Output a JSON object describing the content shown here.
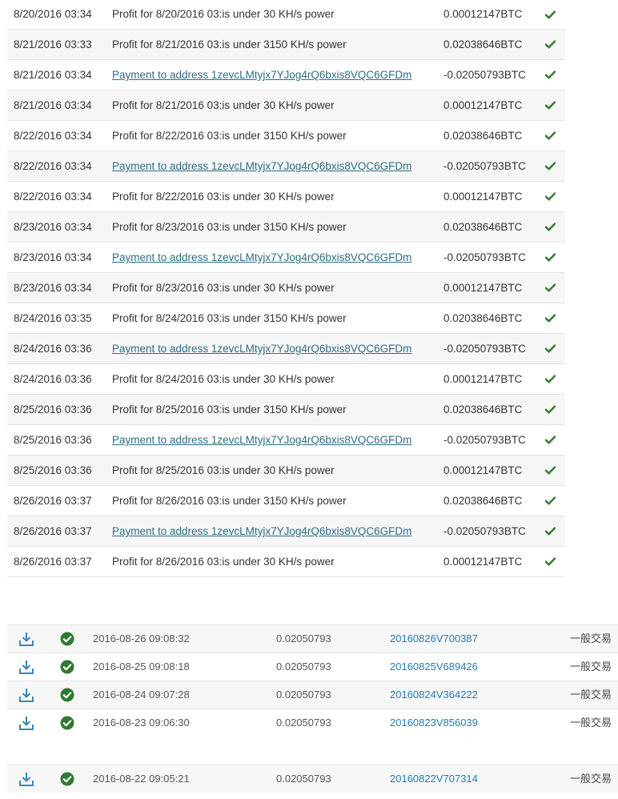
{
  "ledger": {
    "rows": [
      {
        "date": "8/20/2016 03:34",
        "desc": "Profit for 8/20/2016 03:is under 30 KH/s power",
        "amount": "0.00012147BTC",
        "link": false
      },
      {
        "date": "8/21/2016 03:33",
        "desc": "Profit for 8/21/2016 03:is under 3150 KH/s power",
        "amount": "0.02038646BTC",
        "link": false
      },
      {
        "date": "8/21/2016 03:34",
        "desc": "Payment to address 1zevcLMtyjx7YJog4rQ6bxis8VQC6GFDm",
        "amount": "-0.02050793BTC",
        "link": true
      },
      {
        "date": "8/21/2016 03:34",
        "desc": "Profit for 8/21/2016 03:is under 30 KH/s power",
        "amount": "0.00012147BTC",
        "link": false
      },
      {
        "date": "8/22/2016 03:34",
        "desc": "Profit for 8/22/2016 03:is under 3150 KH/s power",
        "amount": "0.02038646BTC",
        "link": false
      },
      {
        "date": "8/22/2016 03:34",
        "desc": "Payment to address 1zevcLMtyjx7YJog4rQ6bxis8VQC6GFDm",
        "amount": "-0.02050793BTC",
        "link": true
      },
      {
        "date": "8/22/2016 03:34",
        "desc": "Profit for 8/22/2016 03:is under 30 KH/s power",
        "amount": "0.00012147BTC",
        "link": false
      },
      {
        "date": "8/23/2016 03:34",
        "desc": "Profit for 8/23/2016 03:is under 3150 KH/s power",
        "amount": "0.02038646BTC",
        "link": false
      },
      {
        "date": "8/23/2016 03:34",
        "desc": "Payment to address 1zevcLMtyjx7YJog4rQ6bxis8VQC6GFDm",
        "amount": "-0.02050793BTC",
        "link": true
      },
      {
        "date": "8/23/2016 03:34",
        "desc": "Profit for 8/23/2016 03:is under 30 KH/s power",
        "amount": "0.00012147BTC",
        "link": false
      },
      {
        "date": "8/24/2016 03:35",
        "desc": "Profit for 8/24/2016 03:is under 3150 KH/s power",
        "amount": "0.02038646BTC",
        "link": false
      },
      {
        "date": "8/24/2016 03:36",
        "desc": "Payment to address 1zevcLMtyjx7YJog4rQ6bxis8VQC6GFDm",
        "amount": "-0.02050793BTC",
        "link": true
      },
      {
        "date": "8/24/2016 03:36",
        "desc": "Profit for 8/24/2016 03:is under 30 KH/s power",
        "amount": "0.00012147BTC",
        "link": false
      },
      {
        "date": "8/25/2016 03:36",
        "desc": "Profit for 8/25/2016 03:is under 3150 KH/s power",
        "amount": "0.02038646BTC",
        "link": false
      },
      {
        "date": "8/25/2016 03:36",
        "desc": "Payment to address 1zevcLMtyjx7YJog4rQ6bxis8VQC6GFDm",
        "amount": "-0.02050793BTC",
        "link": true
      },
      {
        "date": "8/25/2016 03:36",
        "desc": "Profit for 8/25/2016 03:is under 30 KH/s power",
        "amount": "0.00012147BTC",
        "link": false
      },
      {
        "date": "8/26/2016 03:37",
        "desc": "Profit for 8/26/2016 03:is under 3150 KH/s power",
        "amount": "0.02038646BTC",
        "link": false
      },
      {
        "date": "8/26/2016 03:37",
        "desc": "Payment to address 1zevcLMtyjx7YJog4rQ6bxis8VQC6GFDm",
        "amount": "-0.02050793BTC",
        "link": true
      },
      {
        "date": "8/26/2016 03:37",
        "desc": "Profit for 8/26/2016 03:is under 30 KH/s power",
        "amount": "0.00012147BTC",
        "link": false
      }
    ]
  },
  "transactions": {
    "rows": [
      {
        "time": "2016-08-26 09:08:32",
        "amount": "0.02050793",
        "id": "20160826V700387",
        "type": "一般交易"
      },
      {
        "time": "2016-08-25 09:08:18",
        "amount": "0.02050793",
        "id": "20160825V689426",
        "type": "一般交易"
      },
      {
        "time": "2016-08-24 09:07:28",
        "amount": "0.02050793",
        "id": "20160824V364222",
        "type": "一般交易"
      },
      {
        "time": "2016-08-23 09:06:30",
        "amount": "0.02050793",
        "id": "20160823V856039",
        "type": "一般交易"
      },
      {
        "time": "2016-08-22 09:05:21",
        "amount": "0.02050793",
        "id": "20160822V707314",
        "type": "一般交易"
      }
    ]
  },
  "icons": {
    "status_check": "check-icon",
    "download": "download-icon",
    "confirmed": "check-circle-icon"
  },
  "colors": {
    "check_green": "#3a7d3a",
    "confirmed_green": "#2f7a32",
    "link_teal": "#2c6e86",
    "id_blue": "#2a7ab0",
    "download_blue": "#3a86b8"
  }
}
